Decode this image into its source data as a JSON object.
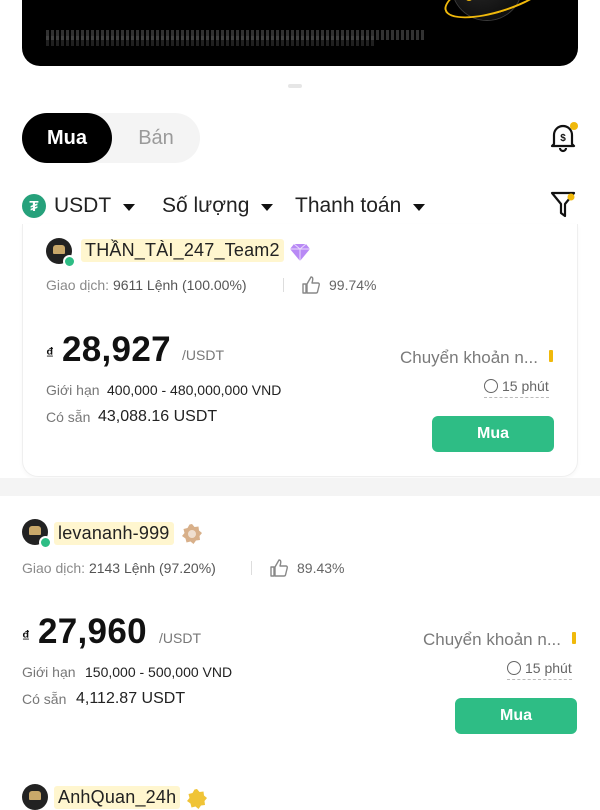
{
  "toggle": {
    "buy_label": "Mua",
    "sell_label": "Bán"
  },
  "filters": {
    "asset_label": "USDT",
    "amount_label": "Số lượng",
    "payment_label": "Thanh toán"
  },
  "colors": {
    "accent_green": "#2ebd85",
    "brand_yellow": "#f0b90b",
    "tether_green": "#26a17b"
  },
  "offers": [
    {
      "merchant": "THẦN_TÀI_247_Team2",
      "badge_icon": "diamond-badge-icon",
      "trade_label": "Giao dịch:",
      "orders": "9611 Lệnh",
      "completion": "(100.00%)",
      "positive_rate": "99.74%",
      "currency_symbol": "₫",
      "price": "28,927",
      "price_unit": "/USDT",
      "payment_method": "Chuyển khoản n...",
      "limit_label": "Giới hạn",
      "limit": "400,000 - 480,000,000 VND",
      "available_label": "Có sẵn",
      "available": "43,088.16 USDT",
      "time_limit": "15 phút",
      "action": "Mua"
    },
    {
      "merchant": "levananh-999",
      "badge_icon": "bronze-badge-icon",
      "trade_label": "Giao dịch:",
      "orders": "2143 Lệnh",
      "completion": "(97.20%)",
      "positive_rate": "89.43%",
      "currency_symbol": "₫",
      "price": "27,960",
      "price_unit": "/USDT",
      "payment_method": "Chuyển khoản n...",
      "limit_label": "Giới hạn",
      "limit": "150,000 - 500,000 VND",
      "available_label": "Có sẵn",
      "available": "4,112.87 USDT",
      "time_limit": "15 phút",
      "action": "Mua"
    },
    {
      "merchant": "AnhQuan_24h",
      "badge_icon": "gold-badge-icon"
    }
  ]
}
